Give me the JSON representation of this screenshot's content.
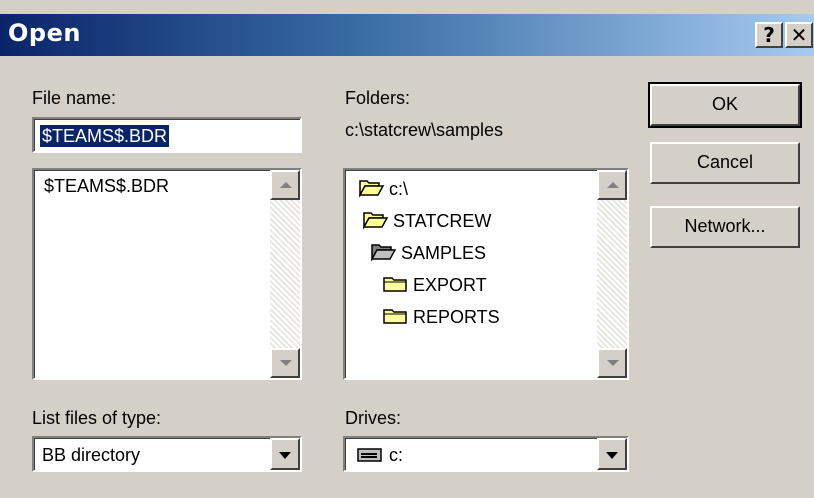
{
  "window": {
    "title": "Open",
    "help_button": "?",
    "close_button": "✕"
  },
  "file_name": {
    "label": "File name:",
    "value": "$TEAMS$.BDR",
    "files": [
      "$TEAMS$.BDR"
    ]
  },
  "folders": {
    "label": "Folders:",
    "current_path": "c:\\statcrew\\samples",
    "tree": [
      {
        "name": "c:\\",
        "icon": "open-folder-icon",
        "state": "open"
      },
      {
        "name": "STATCREW",
        "icon": "open-folder-icon",
        "state": "open"
      },
      {
        "name": "SAMPLES",
        "icon": "open-folder-icon",
        "state": "open-selected"
      },
      {
        "name": "EXPORT",
        "icon": "folder-icon",
        "state": "closed"
      },
      {
        "name": "REPORTS",
        "icon": "folder-icon",
        "state": "closed"
      }
    ]
  },
  "file_type": {
    "label": "List files of type:",
    "selected": "BB directory"
  },
  "drives": {
    "label": "Drives:",
    "selected": "c:",
    "icon": "drive-icon"
  },
  "buttons": {
    "ok": "OK",
    "cancel": "Cancel",
    "network": "Network..."
  },
  "colors": {
    "title_gradient_start": "#0a246a",
    "title_gradient_end": "#a6caf0",
    "face": "#d4d0c8",
    "selection": "#0a246a",
    "folder_fill": "#ffff99"
  }
}
